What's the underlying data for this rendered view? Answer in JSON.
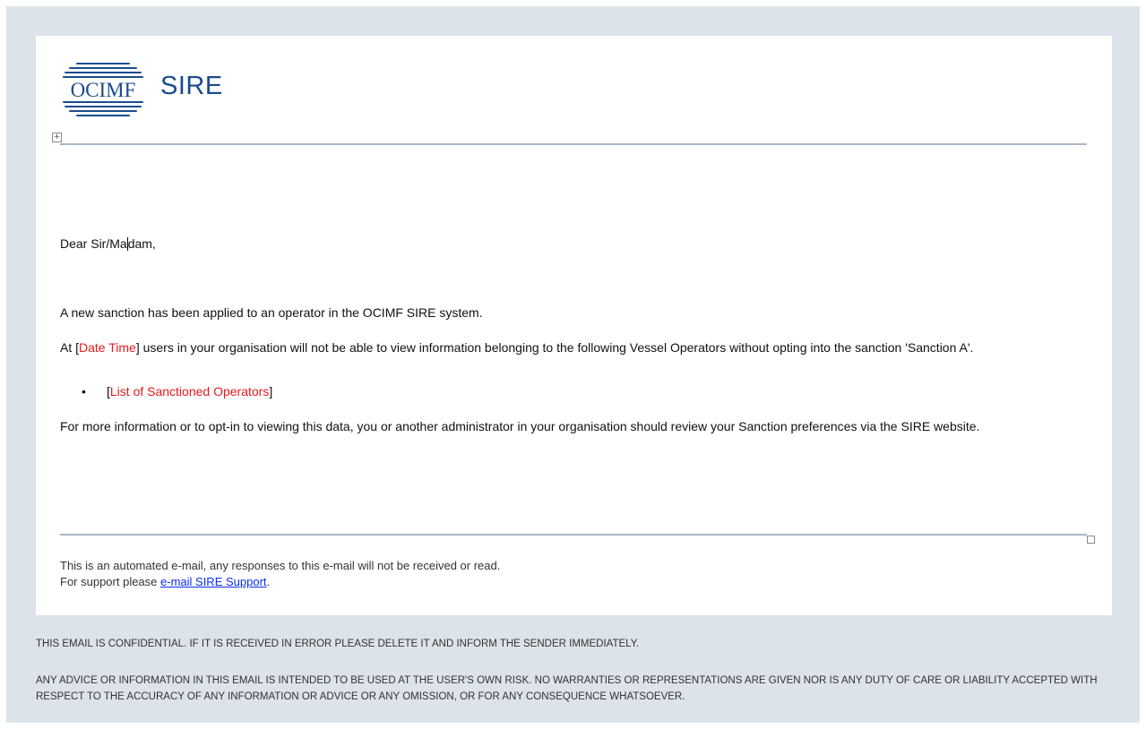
{
  "logo": {
    "org_text": "OCIMF",
    "product_text": "SIRE",
    "brand_color": "#1a4b8c"
  },
  "email": {
    "salutation_before_caret": "Dear Sir/Ma",
    "salutation_after_caret": "dam,",
    "para1": "A new sanction has been applied to an operator in the OCIMF SIRE system.",
    "para2_prefix": "At [",
    "para2_placeholder": "Date Time",
    "para2_suffix": "] users in your organisation will not be able to view information belonging to the following Vessel Operators without opting into the sanction 'Sanction A'.",
    "bullet_open": "[",
    "bullet_placeholder": "List of Sanctioned Operators",
    "bullet_close": "]",
    "para3": "For more information or to opt-in to viewing this data, you or another administrator in your organisation should review your Sanction preferences via the SIRE website."
  },
  "footer": {
    "line1": "This is an automated e-mail, any responses to this e-mail will not be received or read.",
    "line2_prefix": "For support please ",
    "support_link": "e-mail SIRE Support",
    "line2_suffix": "."
  },
  "disclaimer": {
    "line1": "THIS EMAIL IS CONFIDENTIAL. IF IT IS RECEIVED IN ERROR PLEASE DELETE IT AND INFORM THE SENDER IMMEDIATELY.",
    "line2": "ANY ADVICE OR INFORMATION IN THIS EMAIL IS INTENDED TO BE USED AT THE USER'S OWN RISK. NO WARRANTIES OR REPRESENTATIONS ARE GIVEN NOR IS ANY DUTY OF CARE OR LIABILITY ACCEPTED WITH RESPECT TO THE ACCURACY OF ANY INFORMATION OR ADVICE OR ANY OMISSION, OR FOR ANY CONSEQUENCE WHATSOEVER."
  },
  "colors": {
    "placeholder_red": "#e8191c",
    "link_blue": "#0b2ef0",
    "frame_bg": "#dde3ea"
  },
  "icons": {
    "table_move": "table-move-handle-icon",
    "table_resize": "table-resize-handle-icon"
  }
}
